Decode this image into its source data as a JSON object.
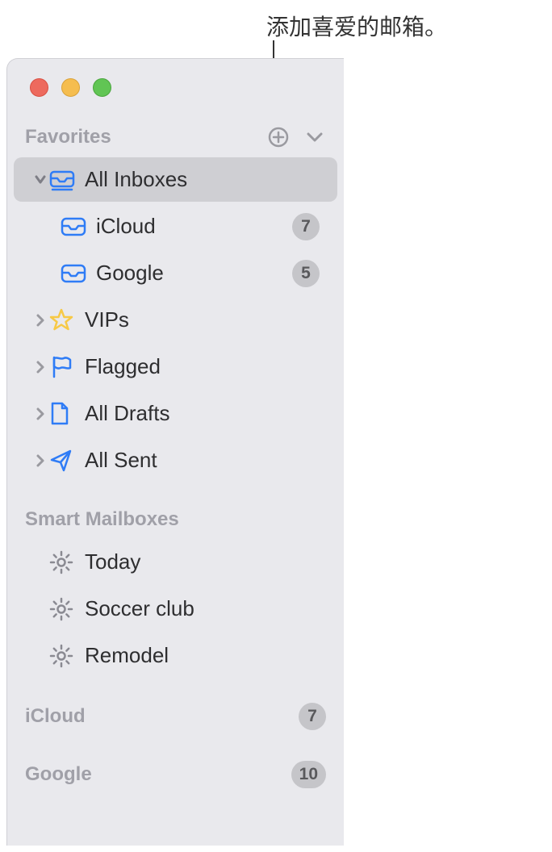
{
  "callout": "添加喜爱的邮箱。",
  "sections": {
    "favorites": {
      "label": "Favorites",
      "items": [
        {
          "label": "All Inboxes",
          "icon": "inbox-stack",
          "selected": true,
          "expanded": true
        },
        {
          "label": "iCloud",
          "icon": "inbox",
          "sub": true,
          "badge": "7"
        },
        {
          "label": "Google",
          "icon": "inbox",
          "sub": true,
          "badge": "5"
        },
        {
          "label": "VIPs",
          "icon": "star",
          "collapsible": true
        },
        {
          "label": "Flagged",
          "icon": "flag",
          "collapsible": true
        },
        {
          "label": "All Drafts",
          "icon": "draft",
          "collapsible": true
        },
        {
          "label": "All Sent",
          "icon": "sent",
          "collapsible": true
        }
      ]
    },
    "smart": {
      "label": "Smart Mailboxes",
      "items": [
        {
          "label": "Today",
          "icon": "gear"
        },
        {
          "label": "Soccer club",
          "icon": "gear"
        },
        {
          "label": "Remodel",
          "icon": "gear"
        }
      ]
    },
    "accounts": [
      {
        "label": "iCloud",
        "badge": "7"
      },
      {
        "label": "Google",
        "badge": "10"
      }
    ]
  },
  "colors": {
    "accent": "#2f7cf6",
    "star": "#f7c946",
    "gear": "#8a8a92"
  }
}
